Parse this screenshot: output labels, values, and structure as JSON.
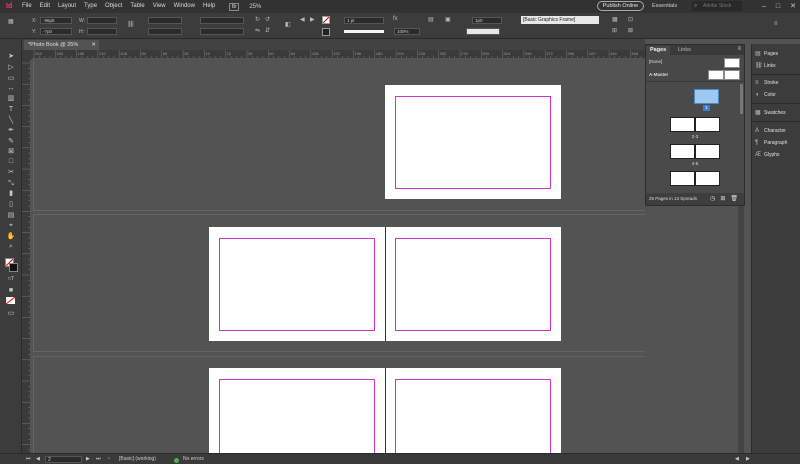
{
  "app": {
    "logo": "Id"
  },
  "menu": [
    "File",
    "Edit",
    "Layout",
    "Type",
    "Object",
    "Table",
    "View",
    "Window",
    "Help"
  ],
  "menubar": {
    "bridge": "Br",
    "zoom": "25%",
    "publish_label": "Publish Online",
    "workspace": "Essentials",
    "search_placeholder": "Adobe Stock"
  },
  "control_bar": {
    "x_label": "X:",
    "y_label": "Y:",
    "w_label": "W:",
    "h_label": "H:",
    "x_value": "-96p5",
    "y_value": "-7p0",
    "stroke_weight": "1 pt",
    "opacity": "100%",
    "corner_value": "1p0",
    "object_style": "[Basic Graphics Frame]"
  },
  "document": {
    "tab_title": "*Photo Book @ 25%"
  },
  "ruler": [
    "204",
    "180",
    "156",
    "132",
    "108",
    "84",
    "60",
    "36",
    "12",
    "12",
    "36",
    "60",
    "84",
    "108",
    "132",
    "156",
    "180",
    "204",
    "228",
    "252",
    "276",
    "300",
    "324",
    "348",
    "372",
    "396",
    "420",
    "444",
    "468",
    "492"
  ],
  "pages_panel": {
    "tabs": [
      "Pages",
      "Links"
    ],
    "none_label": "[None]",
    "master_label": "A-Master",
    "page_labels": [
      "1",
      "2-3",
      "4-5"
    ],
    "summary": "25 Pages in 13 Spreads"
  },
  "dock": [
    "Pages",
    "Links",
    "Stroke",
    "Color",
    "Swatches",
    "Character",
    "Paragraph",
    "Glyphs"
  ],
  "status": {
    "page": "2",
    "preflight": "[Basic] (working)",
    "errors": "No errors"
  },
  "colors": {
    "accent": "#ff3366",
    "margin": "#cc33cc",
    "ok": "#4caf50",
    "selection": "#9fc8f0"
  }
}
